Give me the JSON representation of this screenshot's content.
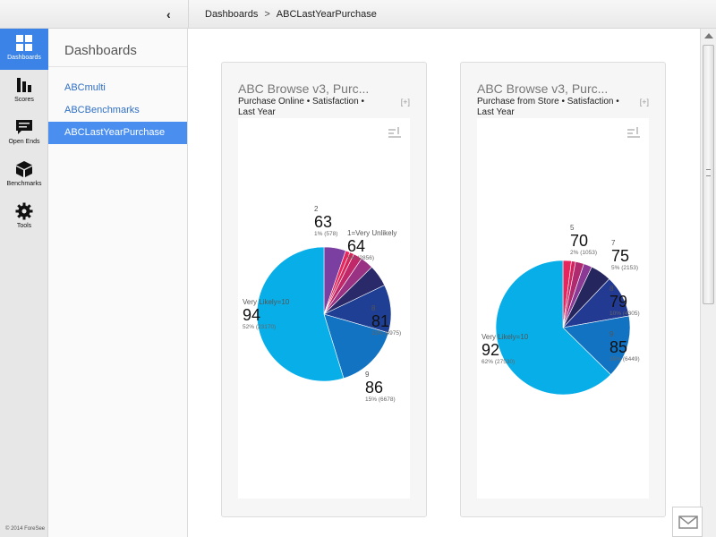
{
  "breadcrumb": {
    "root": "Dashboards",
    "separator": ">",
    "current": "ABCLastYearPurchase"
  },
  "rail": {
    "items": [
      {
        "label": "Dashboards",
        "icon": "grid-icon"
      },
      {
        "label": "Scores",
        "icon": "bar-chart-icon"
      },
      {
        "label": "Open Ends",
        "icon": "speech-bubble-icon"
      },
      {
        "label": "Benchmarks",
        "icon": "cube-icon"
      },
      {
        "label": "Tools",
        "icon": "gear-icon"
      }
    ],
    "copyright": "© 2014 ForeSee"
  },
  "sidebar": {
    "title": "Dashboards",
    "items": [
      {
        "label": "ABCmulti"
      },
      {
        "label": "ABCBenchmarks"
      },
      {
        "label": "ABCLastYearPurchase"
      }
    ]
  },
  "cards": [
    {
      "title": "ABC Browse v3, Purc...",
      "subtitle": "Purchase Online • Satisfaction • Last Year",
      "expand": "[+]"
    },
    {
      "title": "ABC Browse v3, Purc...",
      "subtitle": "Purchase from Store • Satisfaction • Last Year",
      "expand": "[+]"
    }
  ],
  "chart_data": [
    {
      "type": "pie",
      "slices": [
        {
          "label": "1=Very Unlikely",
          "score": "64",
          "detail": "5% (2856)",
          "share": 5,
          "color": "#7a3fa0"
        },
        {
          "label": "2",
          "score": "63",
          "detail": "1% (578)",
          "share": 1,
          "color": "#e8265e"
        },
        {
          "label": "",
          "score": "",
          "detail": "",
          "share": 1,
          "color": "#d8245a"
        },
        {
          "label": "",
          "score": "",
          "detail": "",
          "share": 2,
          "color": "#c0286a"
        },
        {
          "label": "",
          "score": "",
          "detail": "",
          "share": 3,
          "color": "#9a3284"
        },
        {
          "label": "",
          "score": "",
          "detail": "",
          "share": 5,
          "color": "#2a2a6a"
        },
        {
          "label": "8",
          "score": "81",
          "detail": "11% (4975)",
          "share": 11,
          "color": "#1f3f94"
        },
        {
          "label": "9",
          "score": "86",
          "detail": "15% (6678)",
          "share": 15,
          "color": "#1273c2"
        },
        {
          "label": "Very Likely=10",
          "score": "94",
          "detail": "52% (23170)",
          "share": 52,
          "color": "#08aee8"
        }
      ]
    },
    {
      "type": "pie",
      "slices": [
        {
          "label": "5",
          "score": "70",
          "detail": "2% (1053)",
          "share": 2,
          "color": "#e8265e"
        },
        {
          "label": "",
          "score": "",
          "detail": "",
          "share": 1,
          "color": "#cf2460"
        },
        {
          "label": "",
          "score": "",
          "detail": "",
          "share": 2,
          "color": "#b02a70"
        },
        {
          "label": "",
          "score": "",
          "detail": "",
          "share": 2,
          "color": "#8a3a94"
        },
        {
          "label": "7",
          "score": "75",
          "detail": "5% (2153)",
          "share": 5,
          "color": "#26265e"
        },
        {
          "label": "8",
          "score": "79",
          "detail": "10% (4305)",
          "share": 10,
          "color": "#233a92"
        },
        {
          "label": "9",
          "score": "85",
          "detail": "15% (6449)",
          "share": 15,
          "color": "#1273c2"
        },
        {
          "label": "Very Likely=10",
          "score": "92",
          "detail": "62% (27530)",
          "share": 62,
          "color": "#08aee8"
        }
      ]
    }
  ]
}
